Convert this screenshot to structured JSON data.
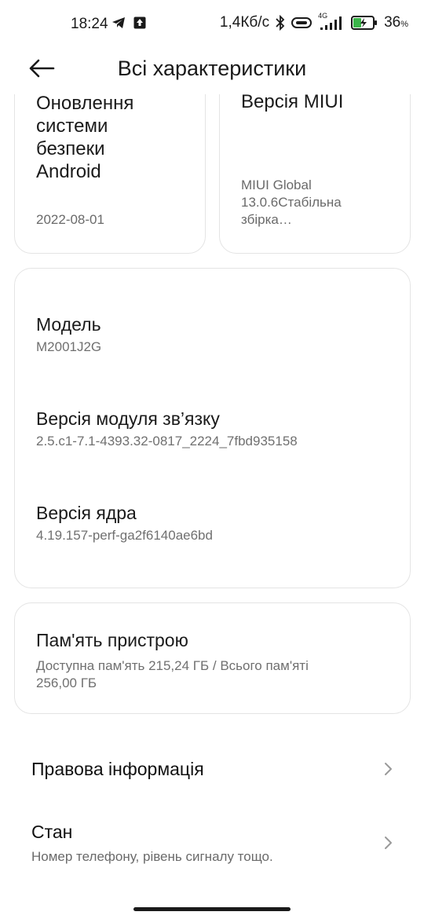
{
  "status_bar": {
    "time": "18:24",
    "speed": "1,4Кб/с",
    "network": "4G",
    "battery_percent": "36"
  },
  "header": {
    "title": "Всі характеристики"
  },
  "cards_top": [
    {
      "title_lines": [
        "Оновлення",
        "системи",
        "безпеки",
        "Android"
      ],
      "value": "2022-08-01"
    },
    {
      "title_lines": [
        "Версія MIUI"
      ],
      "value_lines": [
        "MIUI Global",
        "13.0.6Стабільна",
        "збірка…"
      ]
    }
  ],
  "specs": [
    {
      "title": "Модель",
      "value": "M2001J2G"
    },
    {
      "title": "Версія модуля зв’язку",
      "value": "2.5.c1-7.1-4393.32-0817_2224_7fbd935158"
    },
    {
      "title": "Версія ядра",
      "value": "4.19.157-perf-ga2f6140ae6bd"
    }
  ],
  "memory": {
    "title": "Пам'ять пристрою",
    "value_line1": "Доступна пам'ять  215,24 ГБ / Всього пам'яті",
    "value_line2": "256,00 ГБ"
  },
  "rows": [
    {
      "title": "Правова інформація"
    },
    {
      "title": "Стан",
      "subtitle": "Номер телефону, рівень сигналу тощо."
    }
  ],
  "colors": {
    "accent_battery": "#3bb54a",
    "text_primary": "#1a1a1a",
    "text_secondary": "#707070"
  }
}
